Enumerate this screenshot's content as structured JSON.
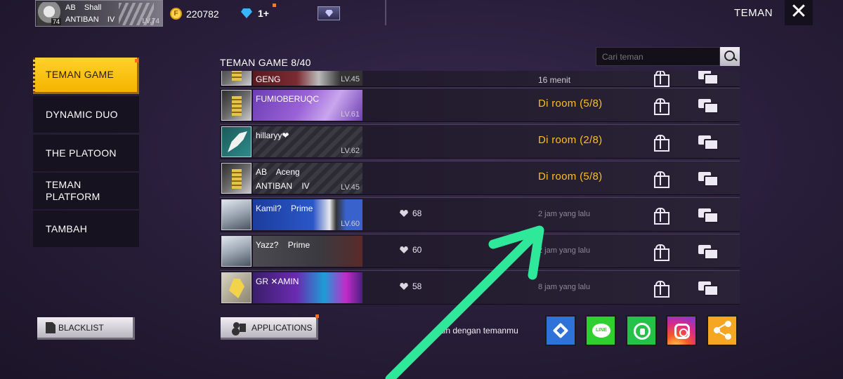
{
  "header": {
    "profile": {
      "line1": "AB    Shall",
      "line2": "ANTIBAN    IV",
      "level": "LV.74",
      "avatar_level": "74"
    },
    "coins": "220782",
    "coin_icon_letter": "F",
    "diamonds": "1+",
    "title": "TEMAN",
    "close_label": "✕"
  },
  "nav": {
    "items": [
      {
        "label": "TEMAN GAME",
        "active": true
      },
      {
        "label": "DYNAMIC DUO"
      },
      {
        "label": "THE PLATOON"
      },
      {
        "label": "TEMAN\nPLATFORM"
      },
      {
        "label": "TAMBAH"
      }
    ],
    "blacklist_label": "BLACKLIST"
  },
  "list": {
    "title": "TEMAN GAME 8/40",
    "search_placeholder": "Cari teman",
    "rows": [
      {
        "name": "GENG",
        "name2": "",
        "level": "LV.45",
        "likes": "",
        "status": "16 menit",
        "status_type": "plain"
      },
      {
        "name": "FUMIOBERUQC",
        "name2": "",
        "level": "LV.61",
        "likes": "",
        "status": "Di room (5/8)",
        "status_type": "room"
      },
      {
        "name": "hillaryy❤",
        "name2": "",
        "level": "LV.62",
        "likes": "",
        "status": "Di room (2/8)",
        "status_type": "room"
      },
      {
        "name": "AB    Aceng",
        "name2": "ANTIBAN    IV",
        "level": "LV.45",
        "likes": "",
        "status": "Di room (5/8)",
        "status_type": "room"
      },
      {
        "name": "Kamil?    Prime",
        "name2": "",
        "level": "LV.60",
        "likes": "68",
        "status": "2 jam yang lalu",
        "status_type": "ago"
      },
      {
        "name": "Yazz?    Prime",
        "name2": "",
        "level": "",
        "likes": "60",
        "status": "2 jam yang lalu",
        "status_type": "ago"
      },
      {
        "name": "GR ✕AMIN",
        "name2": "",
        "level": "",
        "likes": "58",
        "status": "8 jam yang lalu",
        "status_type": "ago"
      }
    ]
  },
  "footer": {
    "applications_label": "APPLICATIONS",
    "invite_text": "ain dengan temanmu",
    "line_label": "LINE",
    "share_buttons": [
      "link",
      "line",
      "whatsapp",
      "instagram",
      "share"
    ]
  },
  "colors": {
    "accent": "#ffc619",
    "room_status": "#ffbf1f",
    "annotation_arrow": "#2fe89a"
  }
}
